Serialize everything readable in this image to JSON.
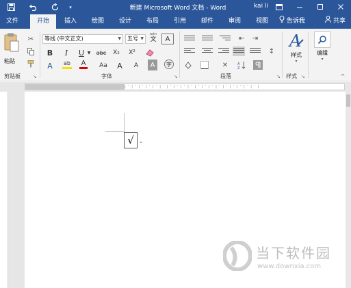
{
  "titlebar": {
    "doc_title": "新建 Microsoft Word 文档 - Word",
    "user": "kai li",
    "quick_access": {
      "save_icon": "save-icon",
      "undo_icon": "undo-icon",
      "redo_icon": "redo-icon",
      "customize_icon": "chevron-down-icon"
    },
    "window_controls": {
      "ribbon_display_icon": "ribbon-display-icon",
      "minimize_icon": "minimize-icon",
      "maximize_icon": "maximize-icon",
      "close_icon": "close-icon"
    }
  },
  "tabs": [
    {
      "label": "文件",
      "active": false
    },
    {
      "label": "开始",
      "active": true
    },
    {
      "label": "插入",
      "active": false
    },
    {
      "label": "绘图",
      "active": false
    },
    {
      "label": "设计",
      "active": false
    },
    {
      "label": "布局",
      "active": false
    },
    {
      "label": "引用",
      "active": false
    },
    {
      "label": "邮件",
      "active": false
    },
    {
      "label": "审阅",
      "active": false
    },
    {
      "label": "视图",
      "active": false
    }
  ],
  "tell_me": "告诉我",
  "share": "共享",
  "ribbon": {
    "clipboard": {
      "label": "剪贴板",
      "paste_label": "粘贴"
    },
    "font": {
      "label": "字体",
      "font_name": "等线 (中文正文)",
      "font_size": "五号",
      "wen_label": "wén",
      "wen_char": "文",
      "bold": "B",
      "italic": "I",
      "underline": "U",
      "strike": "abc",
      "subscript": "X₂",
      "superscript": "X²",
      "case": "Aa",
      "grow": "A",
      "shrink": "A",
      "char_shade": "A",
      "boxed": "A",
      "enclose": "字",
      "effects": "A",
      "highlight": "ab",
      "color": "A"
    },
    "paragraph": {
      "label": "段落"
    },
    "styles": {
      "label": "样式",
      "button": "样式"
    },
    "editing": {
      "button": "编辑"
    },
    "colors": {
      "highlight": "#f5e400",
      "font_color": "#e00000",
      "accent": "#2b579a"
    }
  },
  "document": {
    "checkmark": "√"
  },
  "watermark": {
    "title": "当下软件园",
    "url": "www.downxia.com"
  }
}
